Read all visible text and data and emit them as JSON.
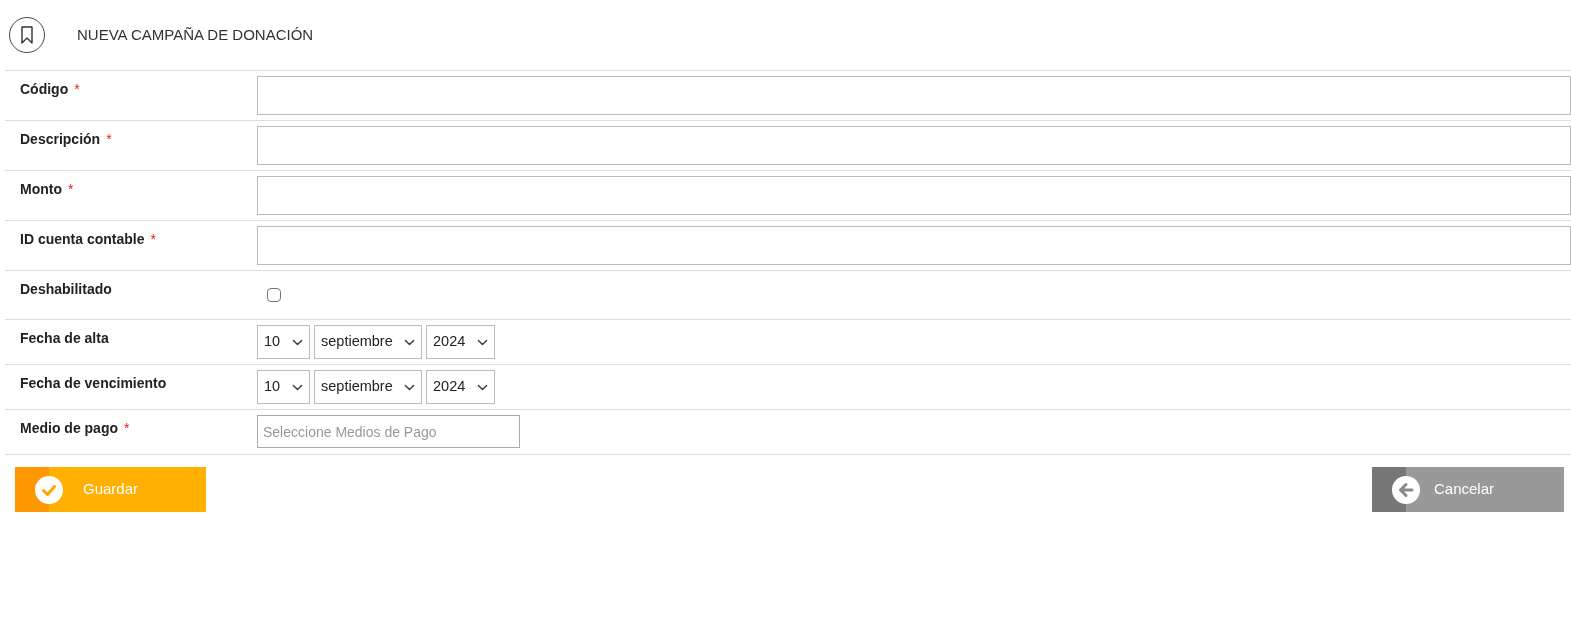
{
  "header": {
    "title": "NUEVA CAMPAÑA DE DONACIÓN"
  },
  "fields": [
    {
      "label": "Código",
      "required_mark": "*",
      "kind": "text"
    },
    {
      "label": "Descripción",
      "required_mark": "*",
      "kind": "text"
    },
    {
      "label": "Monto",
      "required_mark": "*",
      "kind": "text"
    },
    {
      "label": "ID cuenta contable",
      "required_mark": "*",
      "kind": "text"
    },
    {
      "label": "Deshabilitado",
      "kind": "checkbox",
      "checked": false
    },
    {
      "label": "Fecha de alta",
      "kind": "date",
      "day": "10",
      "month": "septiembre",
      "year": "2024"
    },
    {
      "label": "Fecha de vencimiento",
      "kind": "date",
      "day": "10",
      "month": "septiembre",
      "year": "2024"
    },
    {
      "label": "Medio de pago",
      "required_mark": "*",
      "kind": "multiselect",
      "placeholder": "Seleccione Medios de Pago"
    }
  ],
  "buttons": [
    {
      "label": "Guardar",
      "kind": "save"
    },
    {
      "label": "Cancelar",
      "kind": "cancel"
    }
  ]
}
